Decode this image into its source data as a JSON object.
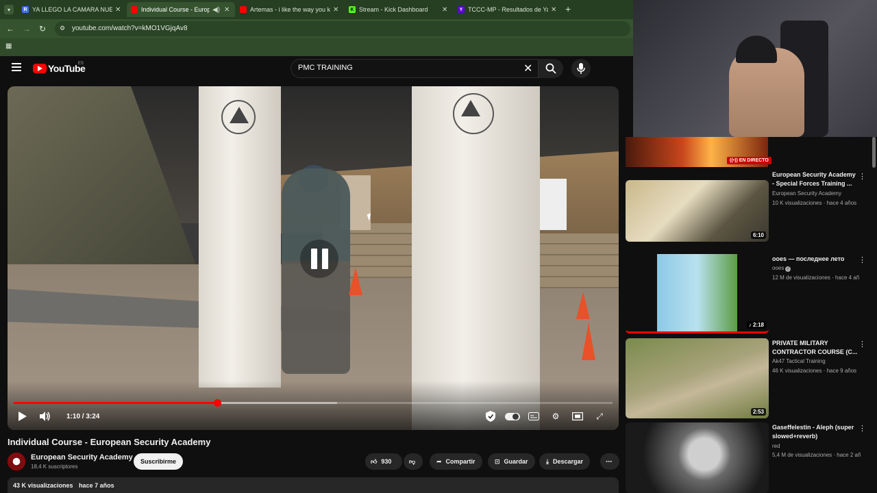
{
  "browser": {
    "tabs": [
      {
        "title": "YA LLEGO LA CAMARA NUEVA",
        "fav": "R",
        "favcolor": "#3d6ef2"
      },
      {
        "title": "Individual Course - European",
        "fav": "",
        "favcolor": "#ff0000"
      },
      {
        "title": "Artemas - i like the way you kiss",
        "fav": "",
        "favcolor": "#ff0000"
      },
      {
        "title": "Stream - Kick Dashboard",
        "fav": "K",
        "favcolor": "#53fc18"
      },
      {
        "title": "TCCC-MP - Resultados de Yahoo",
        "fav": "Y",
        "favcolor": "#6001d2"
      }
    ],
    "new_tab": "+",
    "url": "youtube.com/watch?v=kMO1VGjqAv8"
  },
  "yt": {
    "logo_text": "YouTube",
    "region": "ES",
    "search_query": "PMC TRAINING"
  },
  "player": {
    "time": "1:10 / 3:24",
    "progress_played": 0.34,
    "progress_buffered": 0.54
  },
  "video": {
    "title": "Individual Course - European Security Academy",
    "channel": "European Security Academy",
    "subscribers": "18,4 K suscriptores",
    "subscribe_label": "Suscribirme",
    "likes": "930",
    "share_label": "Compartir",
    "save_label": "Guardar",
    "download_label": "Descargar",
    "views": "43 K visualizaciones",
    "age": "hace 7 años"
  },
  "sidebar": {
    "live_badge": "EN DIRECTO",
    "recommendations": [
      {
        "title": "European Security Academy - Special Forces Training ...",
        "channel": "European Security Academy",
        "meta": "10 K visualizaciones · hace 4 años",
        "duration": "6:10",
        "verified": false
      },
      {
        "title": "ooes — последнее лето",
        "channel": "ooes",
        "meta": "12 M de visualizaciones · hace 4 añ",
        "duration": "2:18",
        "verified": true
      },
      {
        "title": "PRIVATE MILITARY CONTRACTOR COURSE (C...",
        "channel": "Ak47 Tactical Training",
        "meta": "46 K visualizaciones · hace 9 años",
        "duration": "2:53",
        "verified": false
      },
      {
        "title": "Gaseffelestin - Aleph (super slowed+reverb)",
        "channel": "red",
        "meta": "5,4 M de visualizaciones · hace 2 añ",
        "duration": "",
        "verified": false
      }
    ]
  }
}
